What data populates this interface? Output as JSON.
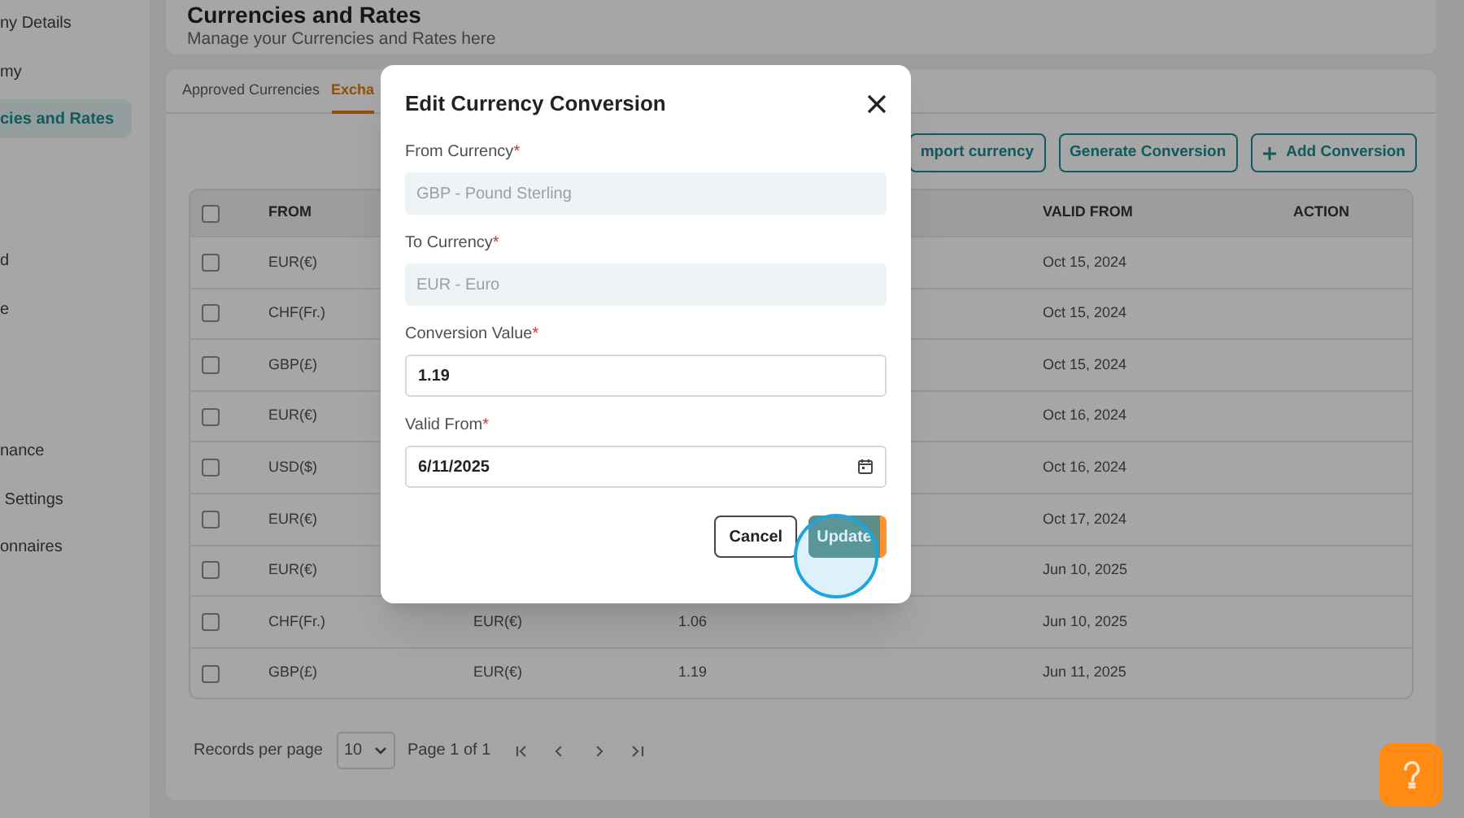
{
  "sidebar": {
    "items": [
      {
        "label": "ny Details",
        "selected": false
      },
      {
        "label": "my",
        "selected": false
      },
      {
        "label": "cies and Rates",
        "selected": true
      },
      {
        "label": "d",
        "selected": false
      },
      {
        "label": "e",
        "selected": false
      },
      {
        "label": "nance",
        "selected": false
      },
      {
        "label": " Settings",
        "selected": false
      },
      {
        "label": "onnaires",
        "selected": false
      }
    ]
  },
  "header": {
    "title": "Currencies and Rates",
    "subtitle": "Manage your Currencies and Rates here"
  },
  "tabs": [
    {
      "label": "Approved Currencies",
      "selected": false
    },
    {
      "label": "Excha",
      "selected": true
    }
  ],
  "toolbar": {
    "buttons": [
      {
        "label": "mport currency",
        "kind": "plain"
      },
      {
        "label": "Generate Conversion",
        "kind": "plain"
      },
      {
        "label": "Add Conversion",
        "kind": "add"
      }
    ]
  },
  "table": {
    "header_checked": false,
    "columns": [
      "FROM",
      "VALID FROM",
      "ACTION"
    ],
    "rows": [
      {
        "checked": false,
        "from": "EUR(€)",
        "valid_from": "Oct 15, 2024"
      },
      {
        "checked": false,
        "from": "CHF(Fr.)",
        "valid_from": "Oct 15, 2024"
      },
      {
        "checked": false,
        "from": "GBP(£)",
        "valid_from": "Oct 15, 2024"
      },
      {
        "checked": false,
        "from": "EUR(€)",
        "valid_from": "Oct 16, 2024"
      },
      {
        "checked": false,
        "from": "USD($)",
        "valid_from": "Oct 16, 2024"
      },
      {
        "checked": false,
        "from": "EUR(€)",
        "valid_from": "Oct 17, 2024"
      },
      {
        "checked": false,
        "from": "EUR(€)",
        "valid_from": "Jun 10, 2025"
      },
      {
        "checked": false,
        "from": "CHF(Fr.)",
        "to": "EUR(€)",
        "value": "1.06",
        "valid_from": "Jun 10, 2025"
      },
      {
        "checked": false,
        "from": "GBP(£)",
        "to": "EUR(€)",
        "value": "1.19",
        "valid_from": "Jun 11, 2025"
      }
    ]
  },
  "pagination": {
    "label": "Records per page",
    "per_page": "10",
    "page": "Page 1 of 1"
  },
  "dialog": {
    "title": "Edit Currency Conversion",
    "fields": [
      {
        "label": "From Currency",
        "required_mark": "*",
        "value": "GBP - Pound Sterling",
        "disabled": true,
        "kind": "text"
      },
      {
        "label": "To Currency",
        "required_mark": "*",
        "value": "EUR - Euro",
        "disabled": true,
        "kind": "text"
      },
      {
        "label": "Conversion Value",
        "required_mark": "*",
        "value": "1.19",
        "disabled": false,
        "kind": "text"
      },
      {
        "label": "Valid From",
        "required_mark": "*",
        "value": "6/11/2025",
        "disabled": false,
        "kind": "date"
      }
    ],
    "buttons": [
      {
        "label": "Cancel",
        "kind": "secondary"
      },
      {
        "label": "Update",
        "kind": "primary"
      }
    ]
  }
}
